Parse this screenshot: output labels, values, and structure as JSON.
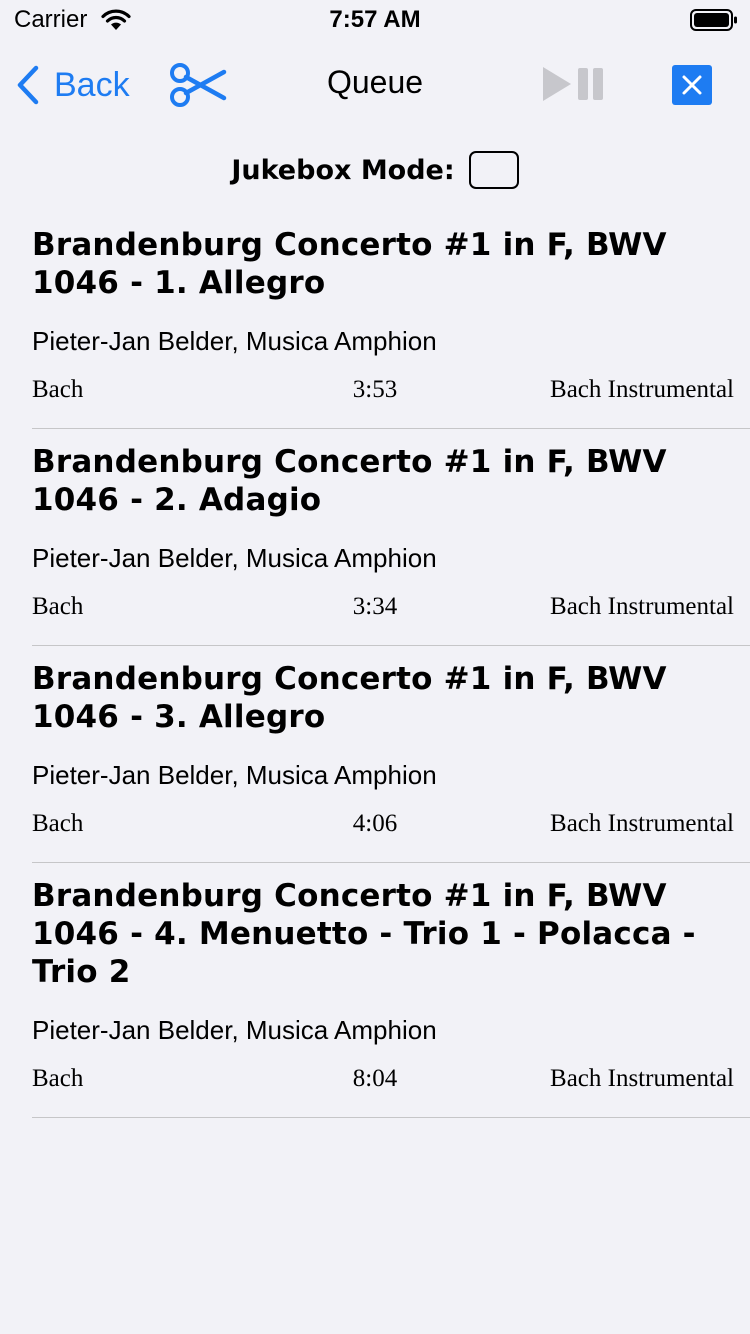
{
  "status_bar": {
    "carrier": "Carrier",
    "time": "7:57 AM"
  },
  "nav": {
    "back_label": "Back",
    "title": "Queue",
    "accent_color": "#1e7cf2",
    "disabled_color": "#c7c7cc",
    "icons": [
      "chevron-left-icon",
      "scissors-icon",
      "play-pause-icon",
      "close-icon"
    ]
  },
  "jukebox": {
    "label": "Jukebox Mode:",
    "checked": false
  },
  "queue": [
    {
      "title": "Brandenburg Concerto #1 in F, BWV 1046 - 1. Allegro",
      "artist": "Pieter-Jan Belder, Musica Amphion",
      "composer": "Bach",
      "duration": "3:53",
      "genre": "Bach Instrumental"
    },
    {
      "title": "Brandenburg Concerto #1 in F, BWV 1046 - 2. Adagio",
      "artist": "Pieter-Jan Belder, Musica Amphion",
      "composer": "Bach",
      "duration": "3:34",
      "genre": "Bach Instrumental"
    },
    {
      "title": "Brandenburg Concerto #1 in F, BWV 1046 - 3. Allegro",
      "artist": "Pieter-Jan Belder, Musica Amphion",
      "composer": "Bach",
      "duration": "4:06",
      "genre": "Bach Instrumental"
    },
    {
      "title": "Brandenburg Concerto #1 in F, BWV 1046 - 4. Menuetto - Trio 1 - Polacca - Trio 2",
      "artist": "Pieter-Jan Belder, Musica Amphion",
      "composer": "Bach",
      "duration": "8:04",
      "genre": "Bach Instrumental"
    }
  ]
}
